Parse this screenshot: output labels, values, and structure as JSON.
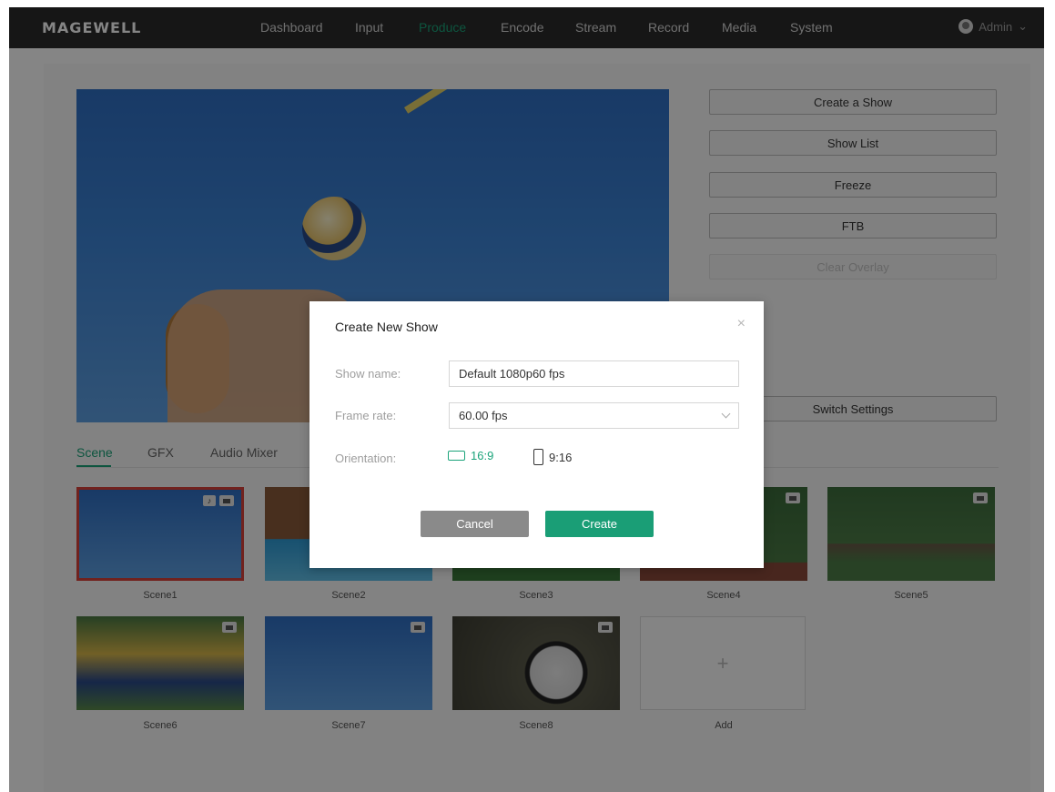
{
  "brand": {
    "logo": "MAGEWELL"
  },
  "nav": {
    "items": [
      {
        "label": "Dashboard"
      },
      {
        "label": "Input"
      },
      {
        "label": "Produce"
      },
      {
        "label": "Encode"
      },
      {
        "label": "Stream"
      },
      {
        "label": "Record"
      },
      {
        "label": "Media"
      },
      {
        "label": "System"
      }
    ],
    "active": "Produce",
    "user": "Admin"
  },
  "controls": {
    "create_show": "Create a Show",
    "show_list": "Show List",
    "freeze": "Freeze",
    "ftb": "FTB",
    "clear_overlay": "Clear Overlay",
    "switch_settings": "Switch Settings"
  },
  "tabs": [
    {
      "label": "Scene"
    },
    {
      "label": "GFX"
    },
    {
      "label": "Audio Mixer"
    }
  ],
  "scenes": [
    {
      "label": "Scene1"
    },
    {
      "label": "Scene2"
    },
    {
      "label": "Scene3"
    },
    {
      "label": "Scene4"
    },
    {
      "label": "Scene5"
    },
    {
      "label": "Scene6"
    },
    {
      "label": "Scene7"
    },
    {
      "label": "Scene8"
    }
  ],
  "add_tile": {
    "icon": "+",
    "label": "Add"
  },
  "modal": {
    "title": "Create New Show",
    "close_icon": "×",
    "show_name_label": "Show name:",
    "show_name_value": "Default 1080p60 fps",
    "frame_rate_label": "Frame rate:",
    "frame_rate_value": "60.00 fps",
    "orientation_label": "Orientation:",
    "orientation_landscape": "16:9",
    "orientation_portrait": "9:16",
    "cancel": "Cancel",
    "create": "Create"
  },
  "colors": {
    "accent": "#1aa37a",
    "selected_border": "#d9413a",
    "nav_bg": "#2b2b2b",
    "cancel_bg": "#8a8a8a"
  }
}
